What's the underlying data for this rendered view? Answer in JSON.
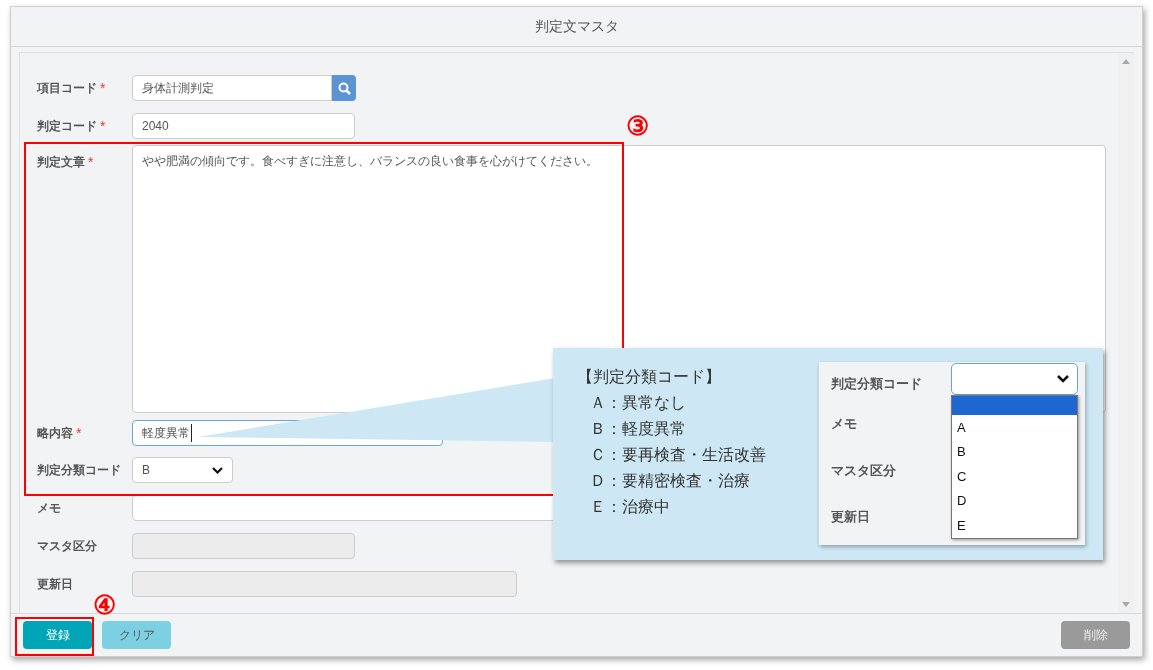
{
  "window": {
    "title": "判定文マスタ"
  },
  "form": {
    "fields": [
      {
        "label": "項目コード",
        "required_mark": "*",
        "kind": "search",
        "value": "身体計測判定"
      },
      {
        "label": "判定コード",
        "required_mark": "*",
        "kind": "text",
        "value": "2040"
      },
      {
        "label": "判定文章",
        "required_mark": "*",
        "kind": "textarea",
        "value": "やや肥満の傾向です。食べすぎに注意し、バランスの良い食事を心がけてください。"
      },
      {
        "label": "略内容",
        "required_mark": "*",
        "kind": "focused",
        "value": "軽度異常"
      },
      {
        "label": "判定分類コード",
        "kind": "select",
        "value": "B"
      },
      {
        "label": "メモ",
        "kind": "text"
      },
      {
        "label": "マスタ区分",
        "kind": "disabled"
      },
      {
        "label": "更新日",
        "kind": "disabled"
      }
    ]
  },
  "footer": {
    "buttons": [
      {
        "label": "登録",
        "kind": "primary"
      },
      {
        "label": "クリア",
        "kind": "secondary"
      },
      {
        "label": "削除",
        "kind": "danger"
      }
    ]
  },
  "annotations": [
    {
      "label": "③"
    },
    {
      "label": "④"
    }
  ],
  "callout": {
    "legend_title": "【判定分類コード】",
    "legend_items": [
      "Ａ：異常なし",
      "Ｂ：軽度異常",
      "Ｃ：要再検査・生活改善",
      "Ｄ：要精密検査・治療",
      "Ｅ：治療中"
    ],
    "inset": {
      "labels": [
        "判定分類コード",
        "メモ",
        "マスタ区分",
        "更新日"
      ],
      "blank_option_highlighted": true,
      "options": [
        {
          "label": "A",
          "selected": false
        },
        {
          "label": "B",
          "selected": false
        },
        {
          "label": "C",
          "selected": false
        },
        {
          "label": "D",
          "selected": false
        },
        {
          "label": "E",
          "selected": false
        }
      ]
    }
  }
}
